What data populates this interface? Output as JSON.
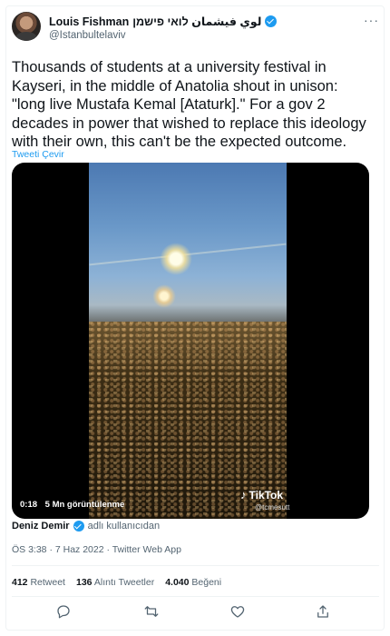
{
  "tweet": {
    "author_name": "Louis Fishman",
    "author_name_alt": "لوي فيشمان לואי פישמן",
    "handle": "@Istanbultelaviv",
    "text": "Thousands of students at a university festival in Kayseri, in the middle of Anatolia shout in unison: \"long live Mustafa Kemal [Ataturk].\" For a gov 2 decades in power that wished to replace this ideology with their own, this can't be the expected outcome.",
    "translate_label": "Tweeti Çevir",
    "video": {
      "duration": "0:18",
      "views": "5 Mn görüntülenme",
      "watermark": "TikTok",
      "watermark_handle": "@tcmesutt"
    },
    "attribution": {
      "name": "Deniz Demir",
      "suffix": "adlı kullanıcıdan"
    },
    "timestamp": "ÖS 3:38 · 7 Haz 2022 · Twitter Web App",
    "stats": {
      "retweets_count": "412",
      "retweets_label": "Retweet",
      "quotes_count": "136",
      "quotes_label": "Alıntı Tweetler",
      "likes_count": "4.040",
      "likes_label": "Beğeni"
    },
    "more_label": "···"
  },
  "colors": {
    "accent": "#1d9bf0",
    "secondary_text": "#536471",
    "primary_text": "#0f1419"
  },
  "icons": [
    "verified-badge-icon",
    "more-icon",
    "reply-icon",
    "retweet-icon",
    "like-icon",
    "share-icon",
    "tiktok-icon"
  ]
}
